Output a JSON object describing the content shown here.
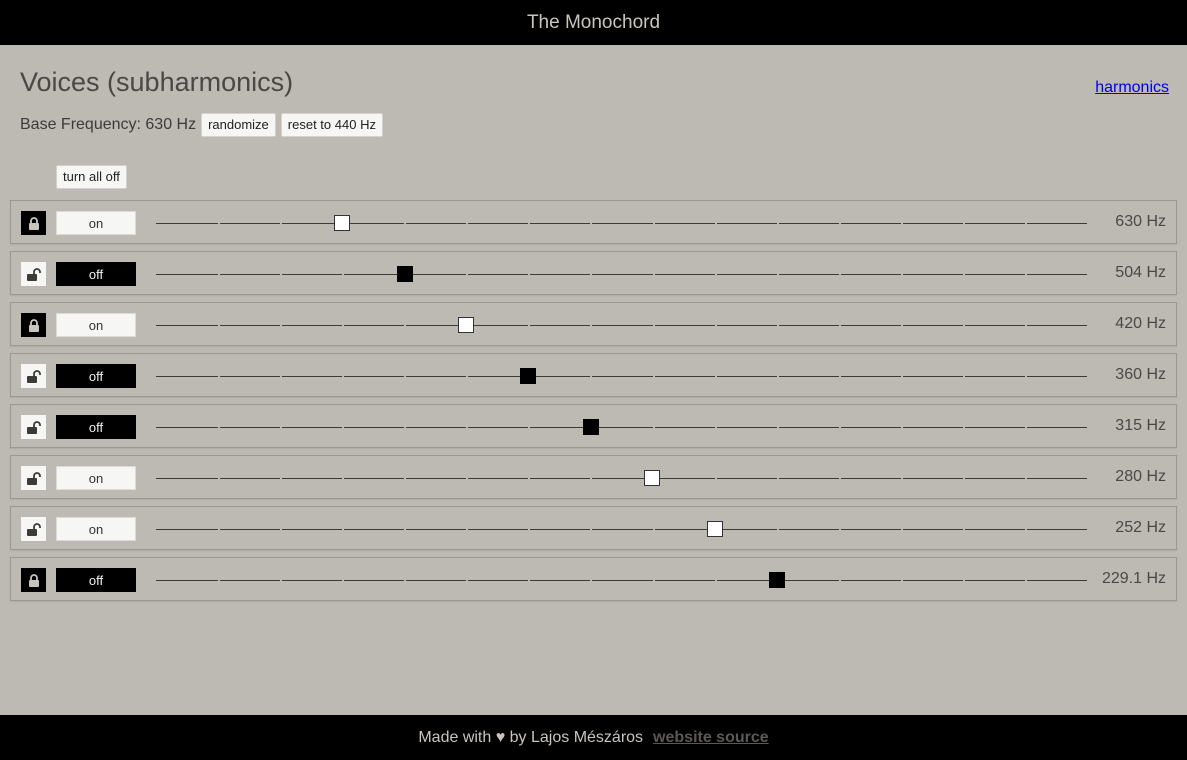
{
  "header": {
    "title": "The Monochord"
  },
  "page": {
    "heading": "Voices (subharmonics)",
    "harmonics_link": "harmonics",
    "base_frequency_text": "Base Frequency: 630 Hz",
    "randomize_label": "randomize",
    "reset_label": "reset to 440 Hz",
    "turn_all_off_label": "turn all off"
  },
  "voices": [
    {
      "locked": true,
      "toggle": "on",
      "slider_fraction": 0.2,
      "freq": "630 Hz"
    },
    {
      "locked": false,
      "toggle": "off",
      "slider_fraction": 0.267,
      "freq": "504 Hz"
    },
    {
      "locked": true,
      "toggle": "on",
      "slider_fraction": 0.333,
      "freq": "420 Hz"
    },
    {
      "locked": false,
      "toggle": "off",
      "slider_fraction": 0.4,
      "freq": "360 Hz"
    },
    {
      "locked": false,
      "toggle": "off",
      "slider_fraction": 0.467,
      "freq": "315 Hz"
    },
    {
      "locked": false,
      "toggle": "on",
      "slider_fraction": 0.533,
      "freq": "280 Hz"
    },
    {
      "locked": false,
      "toggle": "on",
      "slider_fraction": 0.6,
      "freq": "252 Hz"
    },
    {
      "locked": true,
      "toggle": "off",
      "slider_fraction": 0.667,
      "freq": "229.1 Hz"
    }
  ],
  "footer": {
    "made_with": "Made with ♥ by Lajos Mészáros",
    "source_link": "website source"
  },
  "colors": {
    "background": "#bdb9b3",
    "bar": "#000000",
    "link": "#0000ee"
  }
}
